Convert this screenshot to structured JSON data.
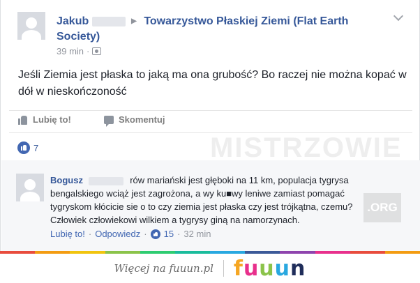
{
  "post": {
    "author": "Jakub",
    "group": "Towarzystwo Płaskiej Ziemi (Flat Earth Society)",
    "time": "39 min",
    "text": "Jeśli Ziemia jest płaska to jaką ma ona grubość? Bo raczej nie można kopać w dół w nieskończoność"
  },
  "actions": {
    "like_label": "Lubię to!",
    "comment_label": "Skomentuj"
  },
  "reactions": {
    "count": "7"
  },
  "comment": {
    "author": "Bogusz",
    "text": "rów mariański jest głęboki na 11 km, populacja tygrysa bengalskiego wciąż jest zagrożona, a wy ku■wy leniwe zamiast pomagać tygryskom kłócicie sie o to czy ziemia jest płaska czy jest trójkątna, czemu? Człowiek człowiekowi wilkiem a tygrysy giną na namorzynach.",
    "like_label": "Lubię to!",
    "reply_label": "Odpowiedz",
    "likes": "15",
    "time": "32 min"
  },
  "watermark": {
    "text": "MISTRZOWIE",
    "suffix": ".ORG"
  },
  "footer": {
    "text": "Więcej na fuuun.pl",
    "logo_letters": [
      "f",
      "u",
      "u",
      "u",
      "n"
    ],
    "logo_colors": [
      "#f5a623",
      "#e8308c",
      "#8bc34a",
      "#29a8e0",
      "#1f2d5a"
    ]
  },
  "colors": {
    "link": "#365899",
    "rainbow": [
      "#e84c3d",
      "#f39c12",
      "#f1c40f",
      "#8bc34a",
      "#2ecc71",
      "#1abc9c",
      "#29a8e0",
      "#3b5998",
      "#8e44ad",
      "#e8308c",
      "#e84c3d",
      "#f39c12"
    ]
  }
}
